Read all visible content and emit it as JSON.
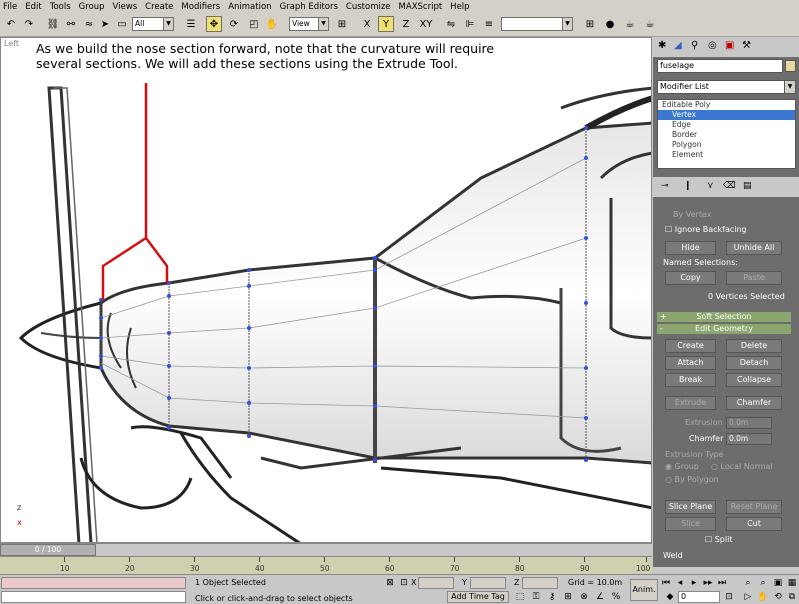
{
  "menu": [
    "File",
    "Edit",
    "Tools",
    "Group",
    "Views",
    "Create",
    "Modifiers",
    "Animation",
    "Graph Editors",
    "Customize",
    "MAXScript",
    "Help"
  ],
  "toolbar": {
    "selection_filter": "All",
    "reference_coord": "View"
  },
  "viewport": {
    "label": "Left",
    "caption_line1": "As we build the nose section forward, note that the curvature will require",
    "caption_line2": "several sections.  We will add these sections using the Extrude Tool.",
    "axis_z": "z",
    "axis_x": "x"
  },
  "panel": {
    "object_name": "fuselage",
    "modifier_list": "Modifier List",
    "stack": [
      "Editable Poly",
      "Vertex",
      "Edge",
      "Border",
      "Polygon",
      "Element"
    ],
    "by_vertex": "By Vertex",
    "ignore_backfacing": "Ignore Backfacing",
    "hide": "Hide",
    "unhide_all": "Unhide All",
    "named_selections": "Named Selections:",
    "copy": "Copy",
    "paste": "Paste",
    "vertices_selected": "0 Vertices Selected",
    "soft_selection": "Soft Selection",
    "edit_geometry": "Edit Geometry",
    "create": "Create",
    "delete": "Delete",
    "attach": "Attach",
    "detach": "Detach",
    "break": "Break",
    "collapse": "Collapse",
    "extrude": "Extrude",
    "chamfer": "Chamfer",
    "extrusion_label": "Extrusion",
    "extrusion_value": "0.0m",
    "chamfer_label": "Chamfer",
    "chamfer_value": "0.0m",
    "extrusion_type": "Extrusion Type",
    "group": "Group",
    "local_normal": "Local Normal",
    "by_polygon": "By Polygon",
    "slice_plane": "Slice Plane",
    "reset_plane": "Reset Plane",
    "slice": "Slice",
    "cut": "Cut",
    "split": "Split",
    "weld": "Weld"
  },
  "timeline": {
    "slider": "0 / 100",
    "ticks": [
      "10",
      "20",
      "30",
      "40",
      "50",
      "60",
      "70",
      "80",
      "90",
      "100"
    ]
  },
  "status": {
    "objects_selected": "1 Object Selected",
    "prompt": "Click or click-and-drag to select objects",
    "x_label": "X",
    "y_label": "Y",
    "z_label": "Z",
    "grid": "Grid = 10.0m",
    "add_time_tag": "Add Time Tag",
    "anim": "Anim.",
    "frame": "0"
  }
}
